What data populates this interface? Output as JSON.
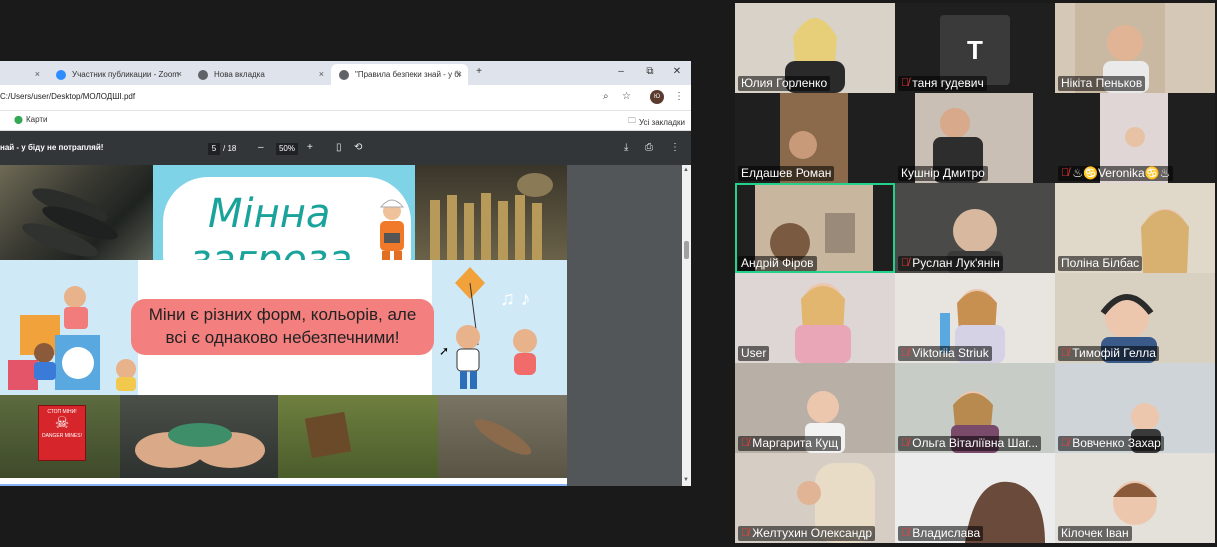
{
  "browser": {
    "tabs": [
      {
        "label": "",
        "favicon_color": "#888888"
      },
      {
        "label": "Участник публикации - Zoom",
        "favicon_color": "#2d8cff"
      },
      {
        "label": "Нова вкладка",
        "favicon_color": "#5f6368"
      },
      {
        "label": "\"Правила безпеки знай - у бі",
        "favicon_color": "#5f6368"
      }
    ],
    "new_tab_symbol": "+",
    "close_symbol": "×",
    "window_controls": {
      "minimize": "–",
      "restore": "⧉",
      "close": "✕"
    },
    "url": "C:/Users/user/Desktop/МОЛОДШІ.pdf",
    "avatar_initials": "Ю",
    "bookmarks": {
      "left": "Карти",
      "right": "Усі закладки"
    },
    "pdf": {
      "title": "най - у біду не потрапляй!",
      "current_page": "5",
      "total_pages": "/ 18",
      "zoom": "50%",
      "zoom_out": "–",
      "zoom_in": "+"
    }
  },
  "slide": {
    "title_line1": "Мінна",
    "title_line2": "загроза",
    "bubble_line1": "Міни є різних форм, кольорів, але",
    "bubble_line2": "всі є однаково небезпечними!",
    "sign_line1": "СТОП МІНИ!",
    "sign_line2": "DANGER MINES!"
  },
  "participants": [
    {
      "name": "Юлия Горленко",
      "muted": false,
      "initial": ""
    },
    {
      "name": "таня гудевич",
      "muted": true,
      "initial": "T"
    },
    {
      "name": "Нікіта Пеньков",
      "muted": false,
      "initial": ""
    },
    {
      "name": "Елдашев Роман",
      "muted": false,
      "initial": ""
    },
    {
      "name": "Кушнір Дмитро",
      "muted": false,
      "initial": ""
    },
    {
      "name": "♨♋Veronika♋♨",
      "muted": true,
      "initial": ""
    },
    {
      "name": "Андрій  Фіров",
      "muted": false,
      "initial": ""
    },
    {
      "name": "Руслан Лук'янін",
      "muted": true,
      "initial": ""
    },
    {
      "name": "Поліна Білбас",
      "muted": false,
      "initial": ""
    },
    {
      "name": "User",
      "muted": false,
      "initial": ""
    },
    {
      "name": "Viktoriia Striuk",
      "muted": true,
      "initial": ""
    },
    {
      "name": "Тимофій Гелла",
      "muted": true,
      "initial": ""
    },
    {
      "name": "Маргарита Кущ",
      "muted": true,
      "initial": ""
    },
    {
      "name": "Ольга Віталіївна Шаг...",
      "muted": true,
      "initial": ""
    },
    {
      "name": "Вовченко Захар",
      "muted": true,
      "initial": ""
    },
    {
      "name": "Желтухин Олександр",
      "muted": true,
      "initial": ""
    },
    {
      "name": "Владислава",
      "muted": true,
      "initial": ""
    },
    {
      "name": "Кілочек Іван",
      "muted": false,
      "initial": ""
    }
  ],
  "colors": {
    "active_speaker": "#23d18b",
    "muted_icon": "#ff3b3b",
    "title_teal": "#1aa39b",
    "bubble": "#f47f7f"
  }
}
